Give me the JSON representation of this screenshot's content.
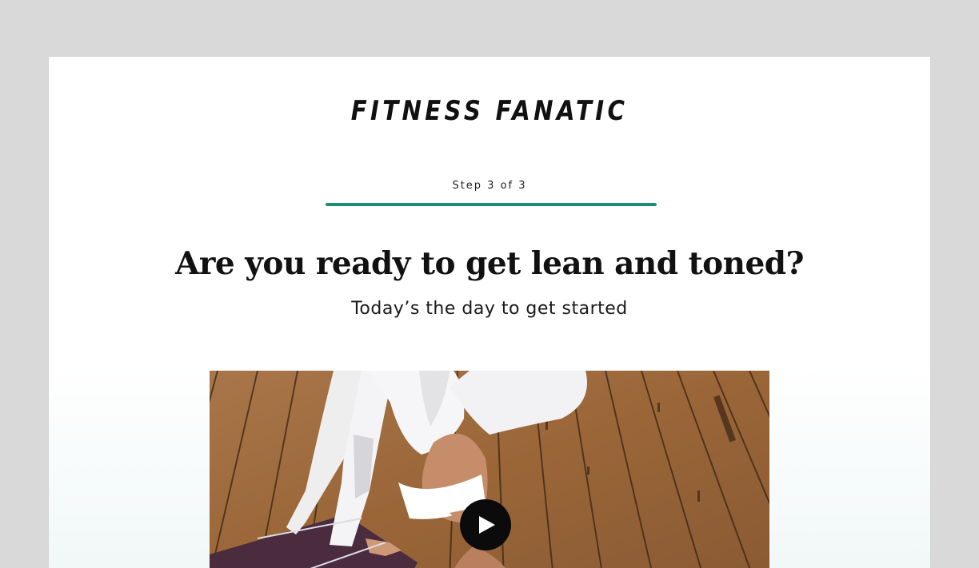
{
  "brand": {
    "logo_text": "FITNESS FANATIC"
  },
  "progress": {
    "step_text": "Step 3 of 3",
    "fraction_complete": 1.0,
    "color": "#179079"
  },
  "hero": {
    "headline": "Are you ready to get lean and toned?",
    "subheadline": "Today’s the day to get started"
  },
  "video": {
    "thumbnail": "yoga-pose-on-wooden-floor",
    "play_icon": "play-icon"
  }
}
